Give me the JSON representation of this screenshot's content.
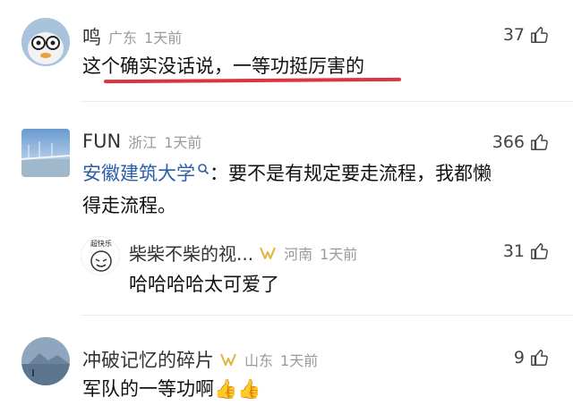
{
  "comments": [
    {
      "user": "鸣",
      "location": "广东",
      "time": "1天前",
      "likes": "37",
      "text": "这个确实没话说，一等功挺厉害的"
    },
    {
      "user": "FUN",
      "location": "浙江",
      "time": "1天前",
      "likes": "366",
      "mention": "安徽建筑大学",
      "text_line1": "：要不是有规定要走流程，我都懒",
      "text_line2": "得走流程。",
      "reply": {
        "user": "柴柴不柴的视...",
        "location": "河南",
        "time": "1天前",
        "likes": "31",
        "text": "哈哈哈哈太可爱了",
        "avatar_caption": "超快乐"
      }
    },
    {
      "user": "冲破记忆的碎片",
      "location": "山东",
      "time": "1天前",
      "likes": "9",
      "text": "军队的一等功啊👍👍"
    }
  ],
  "colors": {
    "mention": "#2b5ea8",
    "highlight_underline": "#d9363e",
    "meta": "#9a9a9a",
    "badge": "#e0b84a"
  },
  "icons": [
    "thumbs-up-icon",
    "search-icon",
    "vip-badge-icon"
  ]
}
